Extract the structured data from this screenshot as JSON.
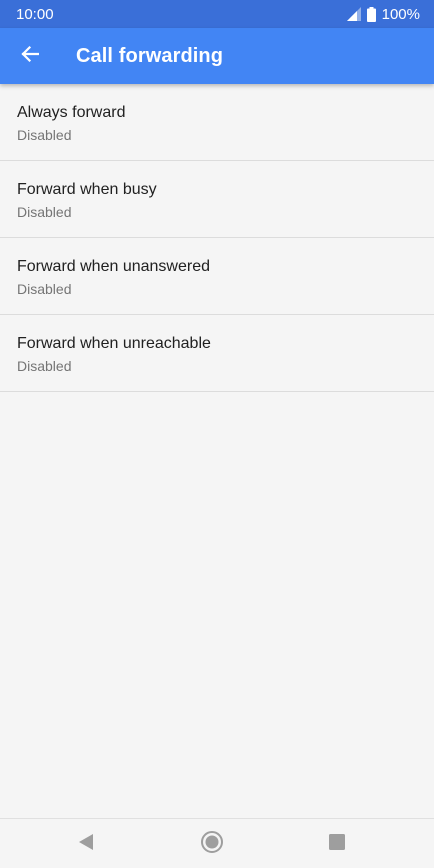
{
  "status_bar": {
    "time": "10:00",
    "battery": "100%",
    "icons": [
      "signal-icon",
      "battery-icon"
    ]
  },
  "app_bar": {
    "title": "Call forwarding",
    "back_icon": "back-arrow-icon",
    "color": "#4285f4",
    "status_color": "#3a6fd8"
  },
  "list": {
    "items": [
      {
        "title": "Always forward",
        "subtitle": "Disabled"
      },
      {
        "title": "Forward when busy",
        "subtitle": "Disabled"
      },
      {
        "title": "Forward when unanswered",
        "subtitle": "Disabled"
      },
      {
        "title": "Forward when unreachable",
        "subtitle": "Disabled"
      }
    ]
  },
  "nav_bar": {
    "icons": [
      "back-triangle-icon",
      "home-circle-icon",
      "recents-square-icon"
    ]
  }
}
